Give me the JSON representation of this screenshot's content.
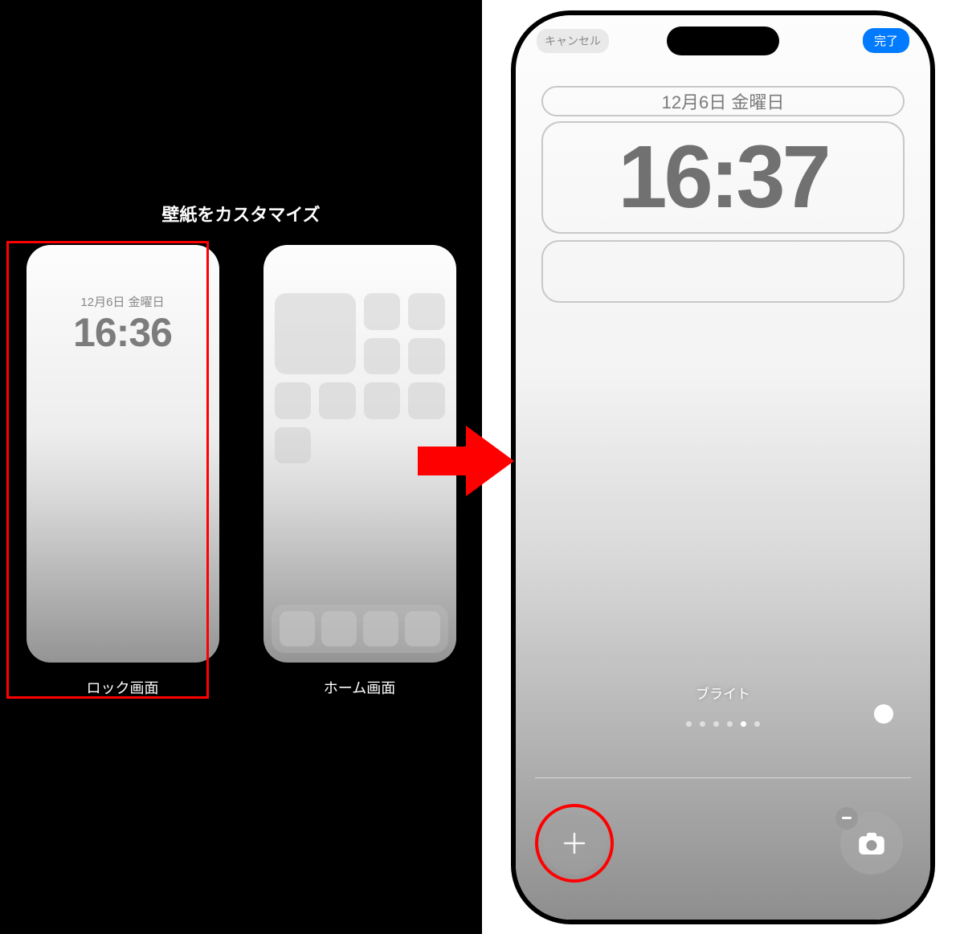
{
  "left": {
    "title": "壁紙をカスタマイズ",
    "lock": {
      "label": "ロック画面",
      "date": "12月6日 金曜日",
      "time": "16:36"
    },
    "home": {
      "label": "ホーム画面"
    }
  },
  "editor": {
    "cancel": "キャンセル",
    "done": "完了",
    "date": "12月6日 金曜日",
    "time": "16:37",
    "filter_name": "ブライト",
    "page_dots": {
      "count": 6,
      "active_index": 4
    }
  }
}
